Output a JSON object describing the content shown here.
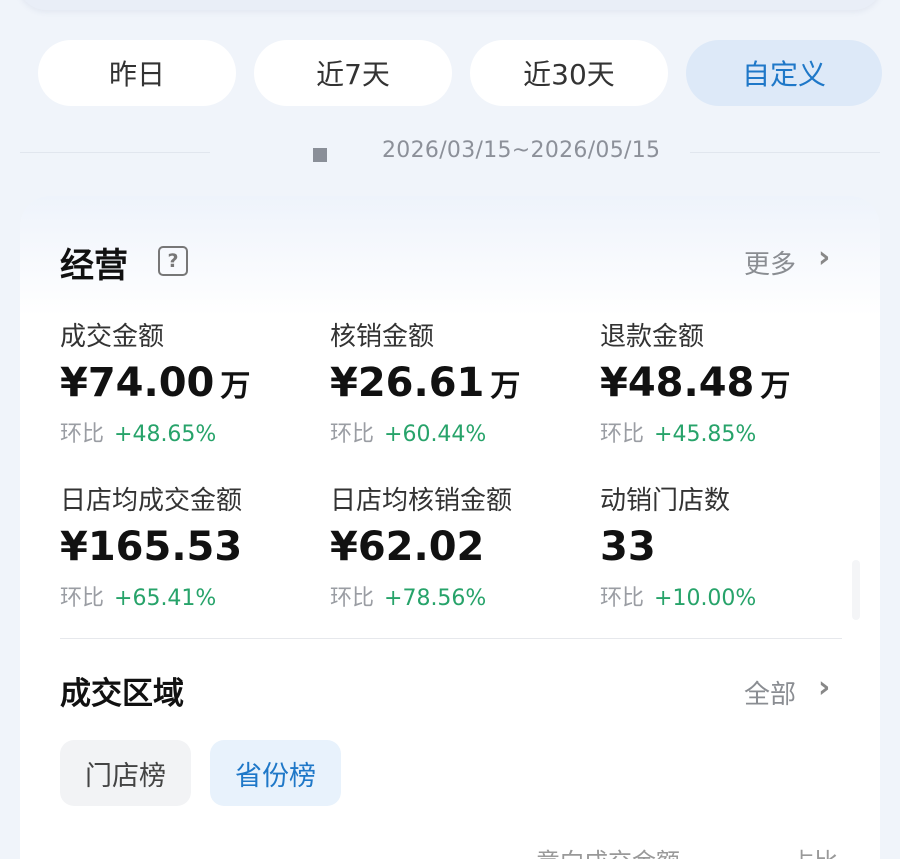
{
  "tabs": [
    {
      "label": "昨日"
    },
    {
      "label": "近7天"
    },
    {
      "label": "近30天"
    },
    {
      "label": "自定义",
      "active": true
    }
  ],
  "date_range": "2026/03/15~2026/05/15",
  "business": {
    "title": "经营",
    "help_icon": "?",
    "more_label": "更多",
    "metrics": [
      {
        "label": "成交金额",
        "value": "¥74.00",
        "unit": "万",
        "change_label": "环比",
        "change": "+48.65%"
      },
      {
        "label": "核销金额",
        "value": "¥26.61",
        "unit": "万",
        "change_label": "环比",
        "change": "+60.44%"
      },
      {
        "label": "退款金额",
        "value": "¥48.48",
        "unit": "万",
        "change_label": "环比",
        "change": "+45.85%"
      },
      {
        "label": "日店均成交金额",
        "value": "¥165.53",
        "unit": "",
        "change_label": "环比",
        "change": "+65.41%"
      },
      {
        "label": "日店均核销金额",
        "value": "¥62.02",
        "unit": "",
        "change_label": "环比",
        "change": "+78.56%"
      },
      {
        "label": "动销门店数",
        "value": "33",
        "unit": "",
        "change_label": "环比",
        "change": "+10.00%"
      }
    ]
  },
  "region": {
    "title": "成交区域",
    "all_label": "全部",
    "chips": [
      {
        "label": "门店榜"
      },
      {
        "label": "省份榜",
        "active": true
      }
    ],
    "columns": [
      "意向成交金额",
      "占比"
    ]
  },
  "colors": {
    "accent": "#1f78c8",
    "positive": "#27a36a",
    "active_tab_bg": "#dde9f8"
  },
  "icons": {
    "chevron": "chevron-right-icon",
    "help": "question-mark-icon",
    "calendar": "calendar-icon"
  }
}
